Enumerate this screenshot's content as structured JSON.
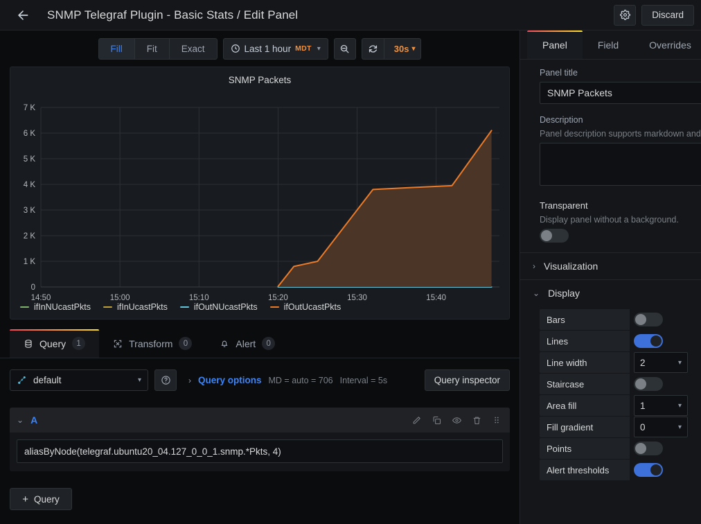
{
  "topbar": {
    "back_icon": "arrow-left-icon",
    "title": "SNMP Telegraf Plugin - Basic Stats / Edit Panel",
    "settings_icon": "gear-icon",
    "discard_label": "Discard"
  },
  "viz_toolbar": {
    "size_modes": [
      {
        "label": "Fill",
        "active": true
      },
      {
        "label": "Fit",
        "active": false
      },
      {
        "label": "Exact",
        "active": false
      }
    ],
    "time_picker": {
      "icon": "clock-icon",
      "range": "Last 1 hour",
      "timezone": "MDT",
      "chevron": "chevron-down-icon"
    },
    "zoom_out_icon": "zoom-out-icon",
    "refresh_icon": "refresh-icon",
    "refresh_interval": "30s"
  },
  "panel": {
    "title": "SNMP Packets"
  },
  "chart_data": {
    "type": "area",
    "title": "SNMP Packets",
    "xlabel": "",
    "ylabel": "",
    "grid": true,
    "legend_position": "bottom-left",
    "x_tick_labels": [
      "14:50",
      "15:00",
      "15:10",
      "15:20",
      "15:30",
      "15:40"
    ],
    "y_tick_labels": [
      "0",
      "1 K",
      "2 K",
      "3 K",
      "4 K",
      "5 K",
      "6 K",
      "7 K"
    ],
    "ylim": [
      0,
      7000
    ],
    "x_axis_start_minutes": 1490,
    "x_axis_end_minutes": 1548,
    "series": [
      {
        "name": "ifInNUcastPkts",
        "color": "#7EB26D",
        "x": [],
        "values": []
      },
      {
        "name": "ifInUcastPkts",
        "color": "#C0A03A",
        "x": [],
        "values": []
      },
      {
        "name": "ifOutNUcastPkts",
        "color": "#65C5DB",
        "x": [
          1520,
          1525,
          1530,
          1535,
          1540,
          1545,
          1547
        ],
        "values": [
          0,
          0,
          0,
          0,
          0,
          0,
          0
        ]
      },
      {
        "name": "ifOutUcastPkts",
        "color": "#EB7B28",
        "fill_color": "#4a3526",
        "x": [
          1520,
          1522,
          1525,
          1532,
          1537,
          1542,
          1547
        ],
        "values": [
          20,
          800,
          1000,
          3800,
          3880,
          3950,
          6100
        ]
      }
    ]
  },
  "edit_tabs": [
    {
      "label": "Query",
      "icon": "database-icon",
      "badge": "1",
      "active": true
    },
    {
      "label": "Transform",
      "icon": "transform-icon",
      "badge": "0",
      "active": false
    },
    {
      "label": "Alert",
      "icon": "bell-icon",
      "badge": "0",
      "active": false
    }
  ],
  "query": {
    "datasource_icon": "graphite-icon",
    "datasource_name": "default",
    "datasource_chevron": "chevron-down-icon",
    "help_icon": "question-circle-icon",
    "options_caret": "chevron-right-icon",
    "options_label": "Query options",
    "options_max_data_points": "MD = auto = 706",
    "options_interval": "Interval = 5s",
    "inspector_label": "Query inspector",
    "rows": [
      {
        "caret": "chevron-down-icon",
        "ref_id": "A",
        "expression": "aliasByNode(telegraf.ubuntu20_04.127_0_0_1.snmp.*Pkts, 4)",
        "actions": [
          "pencil-icon",
          "copy-icon",
          "eye-icon",
          "trash-icon",
          "drag-handle-icon"
        ]
      }
    ],
    "add_query_label": "Query",
    "add_query_icon": "plus-icon"
  },
  "options_pane": {
    "tabs": [
      {
        "label": "Panel",
        "active": true
      },
      {
        "label": "Field",
        "active": false
      },
      {
        "label": "Overrides",
        "active": false
      }
    ],
    "panel_title_label": "Panel title",
    "panel_title_value": "SNMP Packets",
    "description_label": "Description",
    "description_help": "Panel description supports markdown and",
    "description_value": "",
    "transparent_label": "Transparent",
    "transparent_help": "Display panel without a background.",
    "transparent_on": false,
    "visualization_label": "Visualization",
    "visualization_caret": "chevron-right-icon",
    "display_label": "Display",
    "display_caret": "chevron-down-icon",
    "display_rows": [
      {
        "label": "Bars",
        "control": "toggle",
        "on": false
      },
      {
        "label": "Lines",
        "control": "toggle",
        "on": true
      },
      {
        "label": "Line width",
        "control": "select",
        "value": "2"
      },
      {
        "label": "Staircase",
        "control": "toggle",
        "on": false
      },
      {
        "label": "Area fill",
        "control": "select",
        "value": "1"
      },
      {
        "label": "Fill gradient",
        "control": "select",
        "value": "0"
      },
      {
        "label": "Points",
        "control": "toggle",
        "on": false
      },
      {
        "label": "Alert thresholds",
        "control": "toggle",
        "on": true
      }
    ]
  },
  "colors": {
    "accent_blue": "#3d84f5",
    "accent_orange": "#f2913d",
    "toggle_on": "#3d71d9",
    "tab_gradient_start": "#f2495c",
    "tab_gradient_end": "#fade2a"
  }
}
